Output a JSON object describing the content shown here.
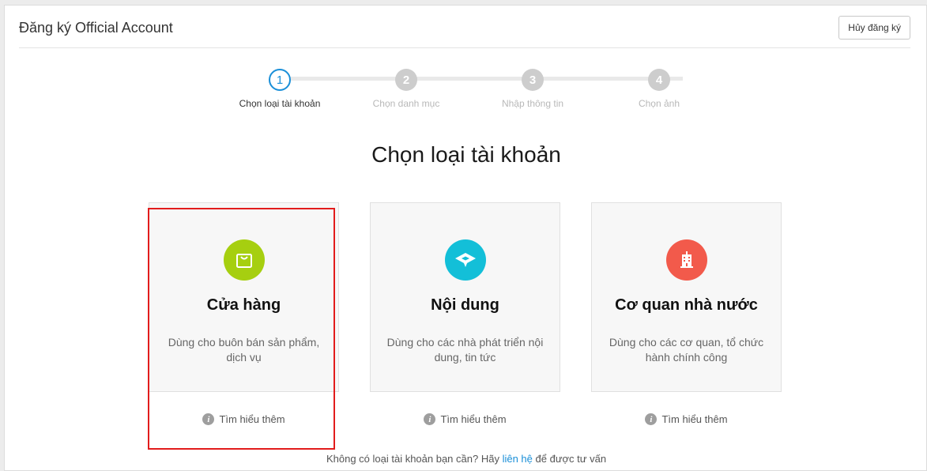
{
  "header": {
    "title": "Đăng ký Official Account",
    "cancel_label": "Hủy đăng ký"
  },
  "stepper": {
    "steps": [
      {
        "number": "1",
        "label": "Chọn loại tài khoản",
        "state": "active"
      },
      {
        "number": "2",
        "label": "Chọn danh mục",
        "state": "inactive"
      },
      {
        "number": "3",
        "label": "Nhập thông tin",
        "state": "inactive"
      },
      {
        "number": "4",
        "label": "Chọn ảnh",
        "state": "inactive"
      }
    ]
  },
  "main": {
    "heading": "Chọn loại tài khoản",
    "cards": [
      {
        "title": "Cửa hàng",
        "description": "Dùng cho buôn bán sản phẩm, dịch vụ",
        "icon": "shopping-bag-icon",
        "color": "#a6cf10",
        "learn_more": "Tìm hiểu thêm"
      },
      {
        "title": "Nội dung",
        "description": "Dùng cho các nhà phát triển nội dung, tin tức",
        "icon": "content-chat-icon",
        "color": "#13bfd8",
        "learn_more": "Tìm hiểu thêm"
      },
      {
        "title": "Cơ quan nhà nước",
        "description": "Dùng cho các cơ quan, tổ chức hành chính công",
        "icon": "government-building-icon",
        "color": "#f25a4b",
        "learn_more": "Tìm hiểu thêm"
      }
    ]
  },
  "footer": {
    "prefix": "Không có loại tài khoản bạn cần? Hãy",
    "link": "liên hệ",
    "suffix": "để được tư vấn"
  },
  "colors": {
    "accent": "#1a8fd8",
    "highlight": "#e21c1c"
  }
}
